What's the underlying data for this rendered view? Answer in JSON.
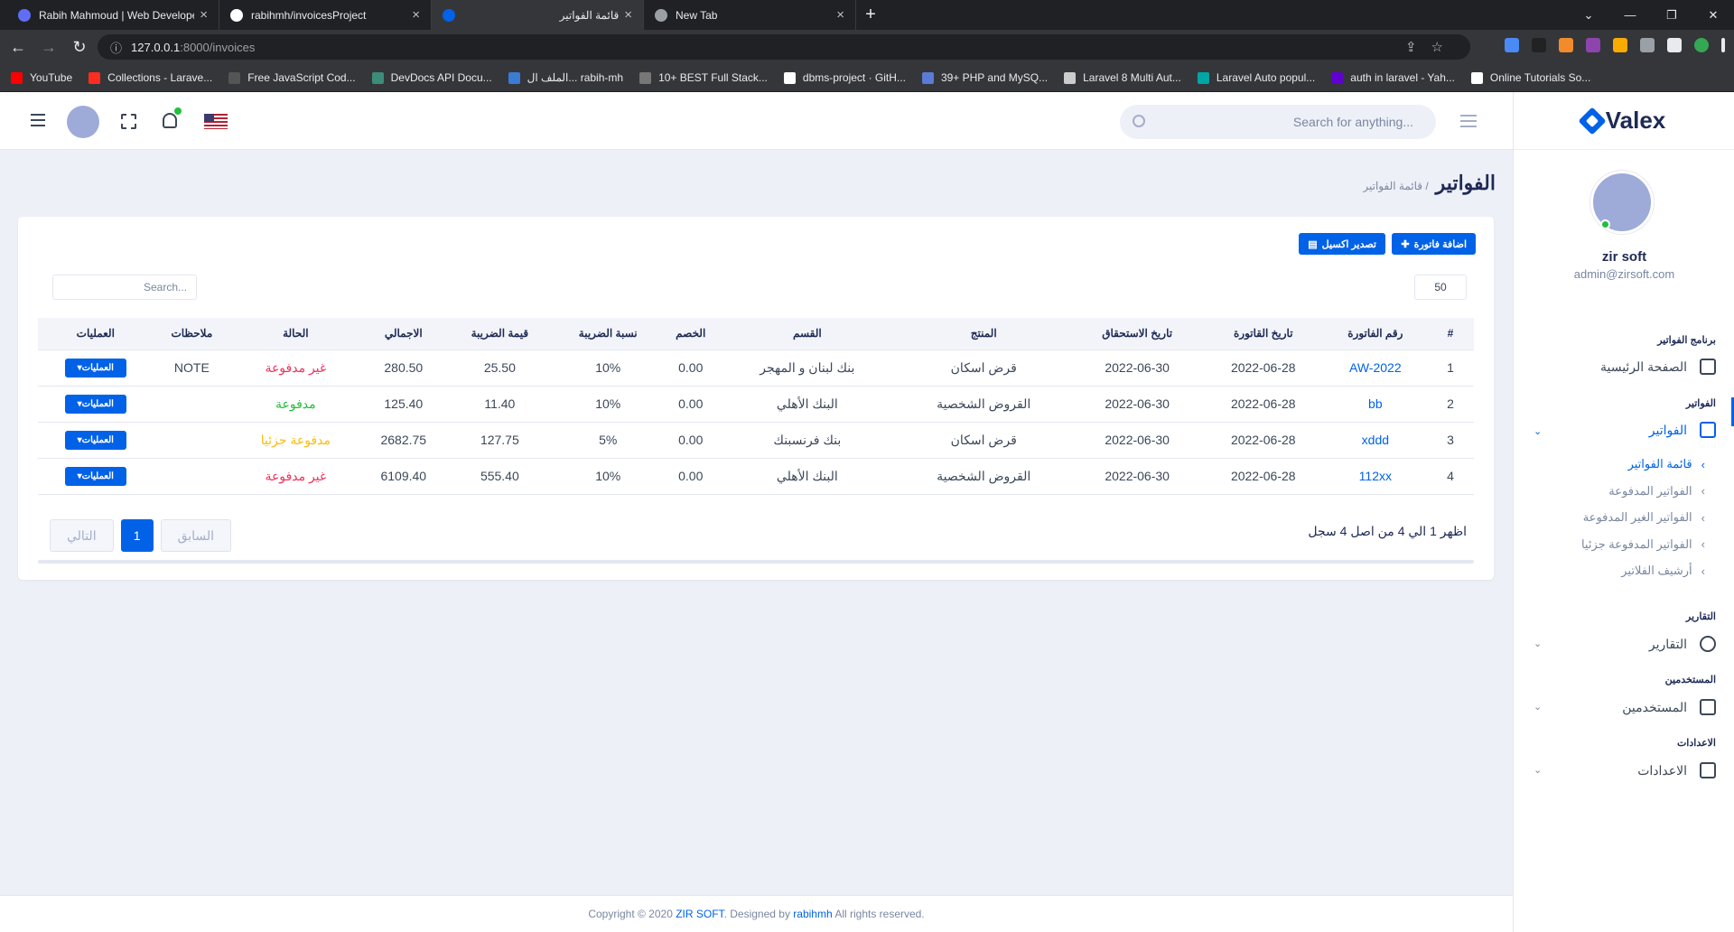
{
  "browser": {
    "tabs": [
      {
        "title": "Rabih Mahmoud | Web Develope",
        "color": "#5f6ef5",
        "active": false
      },
      {
        "title": "rabihmh/invoicesProject",
        "color": "#ffffff",
        "active": false
      },
      {
        "title": "قائمة الفواتير",
        "color": "#0162e8",
        "active": true
      },
      {
        "title": "New Tab",
        "color": "#9aa0a6",
        "active": false
      }
    ],
    "new_tab": "+",
    "url_host": "127.0.0.1",
    "url_path": ":8000/invoices",
    "bookmarks": [
      {
        "label": "YouTube",
        "color": "#ff0000"
      },
      {
        "label": "Collections - Larave...",
        "color": "#ff2d20"
      },
      {
        "label": "Free JavaScript Cod...",
        "color": "#555555"
      },
      {
        "label": "DevDocs API Docu...",
        "color": "#3c8c7a"
      },
      {
        "label": "الملف ال... rabih-mh",
        "color": "#3a7bd5"
      },
      {
        "label": "10+ BEST Full Stack...",
        "color": "#777777"
      },
      {
        "label": "dbms-project · GitH...",
        "color": "#ffffff"
      },
      {
        "label": "39+ PHP and MySQ...",
        "color": "#5b7bd6"
      },
      {
        "label": "Laravel 8 Multi Aut...",
        "color": "#cccccc"
      },
      {
        "label": "Laravel Auto popul...",
        "color": "#00a6a6"
      },
      {
        "label": "auth in laravel - Yah...",
        "color": "#6001d2"
      },
      {
        "label": "Online Tutorials So...",
        "color": "#ffffff"
      }
    ]
  },
  "sidebar": {
    "logo": "Valex",
    "user_name": "zir soft",
    "user_email": "admin@zirsoft.com",
    "sections": {
      "program": "برنامج الفواتير",
      "invoices": "الفواتير",
      "reports": "التقارير",
      "users": "المستخدمين",
      "settings": "الاعدادات"
    },
    "items": {
      "home": "الصفحة الرئيسية",
      "invoices": "الفواتير",
      "reports": "التقارير",
      "users": "المستخدمين",
      "settings": "الاعدادات"
    },
    "sub_items": [
      {
        "label": "قائمة الفواتير",
        "active": true
      },
      {
        "label": "الفواتير المدفوعة",
        "active": false
      },
      {
        "label": "الفواتير الغير المدفوعة",
        "active": false
      },
      {
        "label": "الفواتير المدفوعة جزئيا",
        "active": false
      },
      {
        "label": "أرشيف الفلاتير",
        "active": false
      }
    ]
  },
  "topbar": {
    "search_placeholder": "Search for anything..."
  },
  "page": {
    "title": "الفواتير",
    "breadcrumb": "/ قائمة الفواتير"
  },
  "card": {
    "add_button": "اضافة فاتورة",
    "export_button": "تصدير اكسيل",
    "page_length": "50",
    "search_placeholder": "Search...",
    "columns": [
      "#",
      "رقم الفاتورة",
      "تاريخ القاتورة",
      "تاريخ الاستحقاق",
      "المنتج",
      "القسم",
      "الخصم",
      "نسبة الضريبة",
      "قيمة الضريبة",
      "الاجمالي",
      "الحالة",
      "ملاحظات",
      "العمليات"
    ],
    "rows": [
      {
        "num": "1",
        "invoice": "AW-2022",
        "date": "2022-06-28",
        "due": "2022-06-30",
        "product": "قرض اسكان",
        "section": "بنك لبنان و المهجر",
        "discount": "0.00",
        "rate": "10%",
        "tax": "25.50",
        "total": "280.50",
        "status": "غير مدفوعة",
        "status_type": "red",
        "note": "NOTE",
        "ops": "العمليات"
      },
      {
        "num": "2",
        "invoice": "bb",
        "date": "2022-06-28",
        "due": "2022-06-30",
        "product": "القروض الشخصية",
        "section": "البنك الأهلي",
        "discount": "0.00",
        "rate": "10%",
        "tax": "11.40",
        "total": "125.40",
        "status": "مدفوعة",
        "status_type": "green",
        "note": "",
        "ops": "العمليات"
      },
      {
        "num": "3",
        "invoice": "xddd",
        "date": "2022-06-28",
        "due": "2022-06-30",
        "product": "قرض اسكان",
        "section": "بنك فرنسبنك",
        "discount": "0.00",
        "rate": "5%",
        "tax": "127.75",
        "total": "2682.75",
        "status": "مدفوعة جزئيا",
        "status_type": "orange",
        "note": "",
        "ops": "العمليات"
      },
      {
        "num": "4",
        "invoice": "112xx",
        "date": "2022-06-28",
        "due": "2022-06-30",
        "product": "القروض الشخصية",
        "section": "البنك الأهلي",
        "discount": "0.00",
        "rate": "10%",
        "tax": "555.40",
        "total": "6109.40",
        "status": "غير مدفوعة",
        "status_type": "red",
        "note": "",
        "ops": "العمليات"
      }
    ],
    "info": "اظهر 1 الي 4 من اصل 4 سجل",
    "prev": "السابق",
    "current_page": "1",
    "next": "التالي"
  },
  "footer": {
    "prefix": "Copyright © 2020 ",
    "brand": "ZIR SOFT",
    "designed": ". Designed by ",
    "author": "rabihmh",
    "rest": " All rights reserved."
  }
}
